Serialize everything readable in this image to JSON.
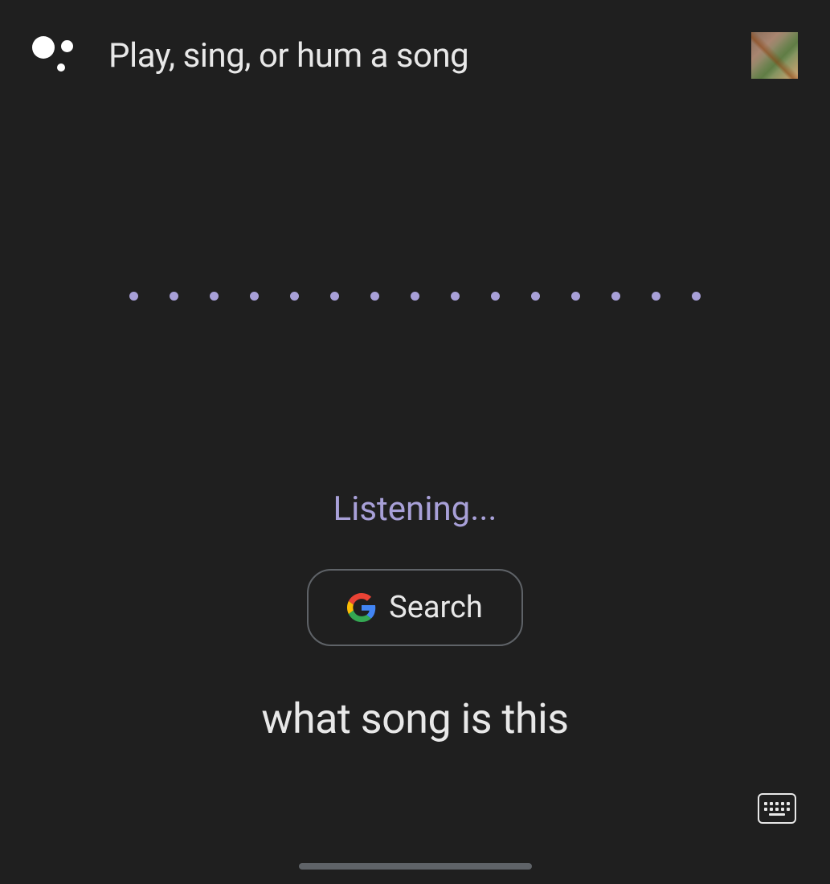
{
  "header": {
    "title": "Play, sing, or hum a song",
    "assistant_icon": "google-assistant-icon"
  },
  "waveform": {
    "dot_count": 15,
    "color": "#a8a0d8"
  },
  "status": {
    "text": "Listening..."
  },
  "search_button": {
    "label": "Search",
    "icon": "google-logo-icon"
  },
  "transcript": {
    "text": "what song is this"
  },
  "footer": {
    "keyboard_icon": "keyboard-icon"
  }
}
